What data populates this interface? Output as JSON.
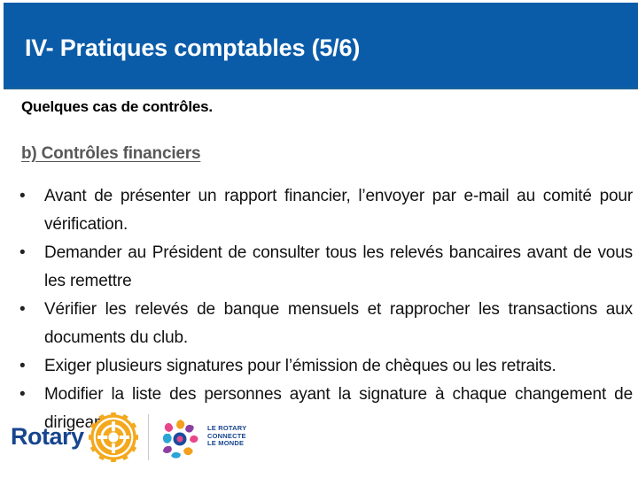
{
  "slide": {
    "title": "IV- Pratiques comptables (5/6)",
    "intro": "Quelques cas de contrôles.",
    "subheading": "b) Contrôles financiers",
    "bullet_marker": "•",
    "bullets": [
      "Avant de présenter un rapport financier, l’envoyer par e-mail au comité pour vérification.",
      "Demander au Président de consulter tous les relevés bancaires avant de vous les remettre",
      "Vérifier les relevés de banque mensuels et rapprocher les transactions aux documents du club.",
      "Exiger plusieurs signatures pour l’émission de chèques ou les retraits.",
      "Modifier la liste des personnes ayant la signature à chaque changement de dirigeants."
    ]
  },
  "logo": {
    "wordmark": "Rotary",
    "tagline_line1": "LE ROTARY",
    "tagline_line2": "CONNECTE",
    "tagline_line3": "LE MONDE"
  },
  "colors": {
    "banner_blue": "#0a5ca8",
    "title_white": "#ffffff",
    "subhead_gray": "#585858",
    "body_black": "#111111",
    "rotary_blue": "#17458f",
    "rotary_gold": "#f7a81b"
  }
}
